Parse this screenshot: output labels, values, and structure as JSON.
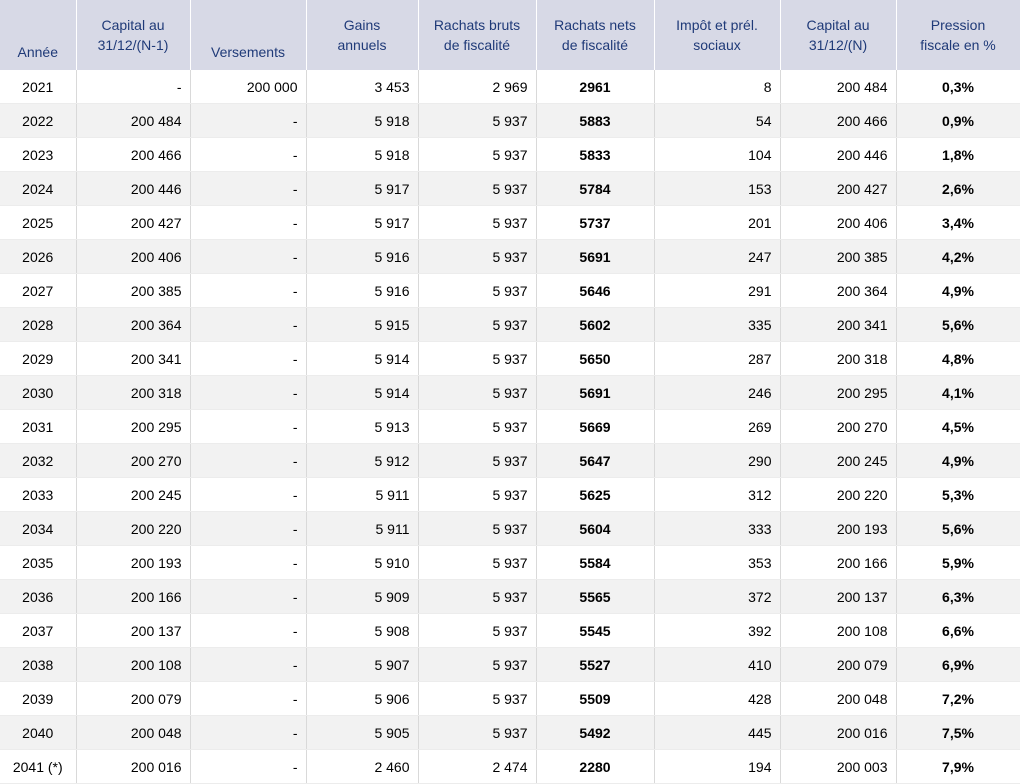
{
  "headers": [
    "Année",
    "Capital au 31/12/(N-1)",
    "Versements",
    "Gains annuels",
    "Rachats bruts de fiscalité",
    "Rachats nets de fiscalité",
    "Impôt et prél. sociaux",
    "Capital au 31/12/(N)",
    "Pression fiscale en %"
  ],
  "header_lines": [
    [
      "Année"
    ],
    [
      "Capital au",
      "31/12/(N-1)"
    ],
    [
      "Versements"
    ],
    [
      "Gains",
      "annuels"
    ],
    [
      "Rachats bruts",
      "de fiscalité"
    ],
    [
      "Rachats nets",
      "de fiscalité"
    ],
    [
      "Impôt et prél.",
      "sociaux"
    ],
    [
      "Capital au",
      "31/12/(N)"
    ],
    [
      "Pression",
      "fiscale en %"
    ]
  ],
  "rows": [
    [
      "2021",
      "-",
      "200 000",
      "3 453",
      "2 969",
      "2961",
      "8",
      "200 484",
      "0,3%"
    ],
    [
      "2022",
      "200 484",
      "-",
      "5 918",
      "5 937",
      "5883",
      "54",
      "200 466",
      "0,9%"
    ],
    [
      "2023",
      "200 466",
      "-",
      "5 918",
      "5 937",
      "5833",
      "104",
      "200 446",
      "1,8%"
    ],
    [
      "2024",
      "200 446",
      "-",
      "5 917",
      "5 937",
      "5784",
      "153",
      "200 427",
      "2,6%"
    ],
    [
      "2025",
      "200 427",
      "-",
      "5 917",
      "5 937",
      "5737",
      "201",
      "200 406",
      "3,4%"
    ],
    [
      "2026",
      "200 406",
      "-",
      "5 916",
      "5 937",
      "5691",
      "247",
      "200 385",
      "4,2%"
    ],
    [
      "2027",
      "200 385",
      "-",
      "5 916",
      "5 937",
      "5646",
      "291",
      "200 364",
      "4,9%"
    ],
    [
      "2028",
      "200 364",
      "-",
      "5 915",
      "5 937",
      "5602",
      "335",
      "200 341",
      "5,6%"
    ],
    [
      "2029",
      "200 341",
      "-",
      "5 914",
      "5 937",
      "5650",
      "287",
      "200 318",
      "4,8%"
    ],
    [
      "2030",
      "200 318",
      "-",
      "5 914",
      "5 937",
      "5691",
      "246",
      "200 295",
      "4,1%"
    ],
    [
      "2031",
      "200 295",
      "-",
      "5 913",
      "5 937",
      "5669",
      "269",
      "200 270",
      "4,5%"
    ],
    [
      "2032",
      "200 270",
      "-",
      "5 912",
      "5 937",
      "5647",
      "290",
      "200 245",
      "4,9%"
    ],
    [
      "2033",
      "200 245",
      "-",
      "5 911",
      "5 937",
      "5625",
      "312",
      "200 220",
      "5,3%"
    ],
    [
      "2034",
      "200 220",
      "-",
      "5 911",
      "5 937",
      "5604",
      "333",
      "200 193",
      "5,6%"
    ],
    [
      "2035",
      "200 193",
      "-",
      "5 910",
      "5 937",
      "5584",
      "353",
      "200 166",
      "5,9%"
    ],
    [
      "2036",
      "200 166",
      "-",
      "5 909",
      "5 937",
      "5565",
      "372",
      "200 137",
      "6,3%"
    ],
    [
      "2037",
      "200 137",
      "-",
      "5 908",
      "5 937",
      "5545",
      "392",
      "200 108",
      "6,6%"
    ],
    [
      "2038",
      "200 108",
      "-",
      "5 907",
      "5 937",
      "5527",
      "410",
      "200 079",
      "6,9%"
    ],
    [
      "2039",
      "200 079",
      "-",
      "5 906",
      "5 937",
      "5509",
      "428",
      "200 048",
      "7,2%"
    ],
    [
      "2040",
      "200 048",
      "-",
      "5 905",
      "5 937",
      "5492",
      "445",
      "200 016",
      "7,5%"
    ],
    [
      "2041 (*)",
      "200 016",
      "-",
      "2 460",
      "2 474",
      "2280",
      "194",
      "200 003",
      "7,9%"
    ]
  ],
  "colors": {
    "header_bg": "#d7d9e6",
    "header_text": "#1f3a78",
    "row_alt_bg": "#f2f2f2"
  }
}
